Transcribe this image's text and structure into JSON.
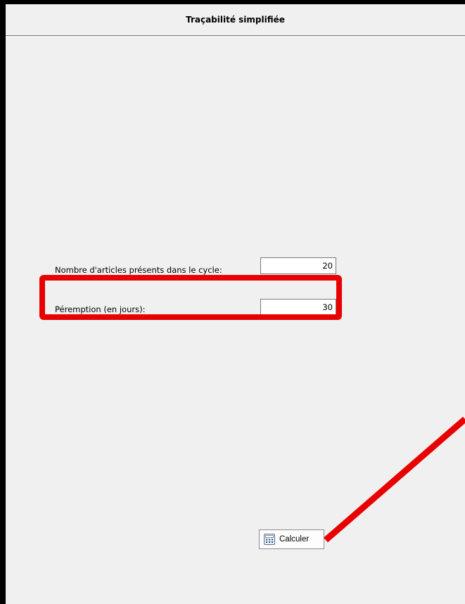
{
  "window": {
    "title": "Traçabilité simplifiée"
  },
  "form": {
    "articles": {
      "label": "Nombre d'articles présents dans le cycle:",
      "value": "20"
    },
    "peremption": {
      "label": "Péremption (en jours):",
      "value": "30"
    }
  },
  "actions": {
    "calculate_label": "Calculer",
    "calculate_icon": "calculator-icon"
  },
  "annotations": {
    "highlight_color": "#e80000"
  }
}
